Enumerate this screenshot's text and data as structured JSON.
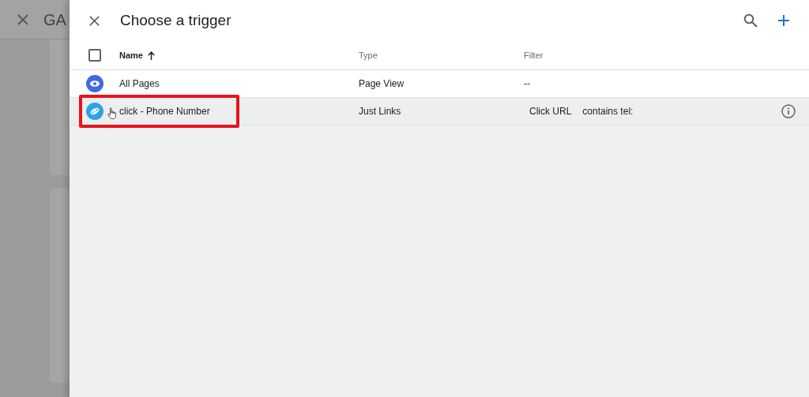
{
  "background_page": {
    "title": "GA"
  },
  "panel": {
    "title": "Choose a trigger",
    "table": {
      "columns": [
        {
          "label": "Name",
          "sorted": true
        },
        {
          "label": "Type",
          "sorted": false
        },
        {
          "label": "Filter",
          "sorted": false
        }
      ],
      "select_all": {
        "checked": false
      },
      "rows": [
        {
          "kind": "pageview",
          "name": "All Pages",
          "type": "Page View",
          "filter": [
            "--"
          ],
          "highlighted": false,
          "annotated": false
        },
        {
          "kind": "link",
          "name": "click - Phone Number",
          "type": "Just Links",
          "filter": [
            "Click URL",
            "contains tel:"
          ],
          "highlighted": true,
          "annotated": true
        }
      ]
    }
  }
}
